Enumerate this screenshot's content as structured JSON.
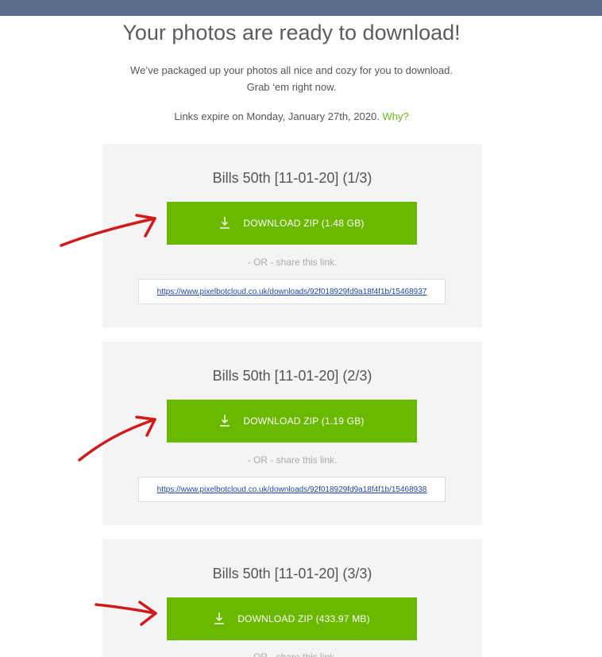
{
  "page": {
    "title": "Your photos are ready to download!",
    "intro_line1": "We’ve packaged up your photos all nice and cozy for you to download.",
    "intro_line2": "Grab ‘em right now.",
    "expire_text": "Links expire on Monday, January 27th, 2020.",
    "why_label": "Why?"
  },
  "downloads": [
    {
      "title": "Bills 50th [11-01-20] (1/3)",
      "button_label": "DOWNLOAD ZIP (1.48 GB)",
      "or_text": "- OR - share this link.",
      "link": "https://www.pixelbotcloud.co.uk/downloads/92f018929fd9a18f4f1b/15468937"
    },
    {
      "title": "Bills 50th [11-01-20] (2/3)",
      "button_label": "DOWNLOAD ZIP (1.19 GB)",
      "or_text": "- OR - share this link.",
      "link": "https://www.pixelbotcloud.co.uk/downloads/92f018929fd9a18f4f1b/15468938"
    },
    {
      "title": "Bills 50th [11-01-20] (3/3)",
      "button_label": "DOWNLOAD ZIP (433.97 MB)",
      "or_text": "- OR - share this link.",
      "link": ""
    }
  ],
  "colors": {
    "header_bar": "#5a6e8c",
    "button_green": "#6ab900",
    "why_green": "#67b91a",
    "link_blue": "#1f47a8",
    "annotation_red": "#d11a1a"
  },
  "icons": {
    "download": "download-arrow-icon"
  }
}
